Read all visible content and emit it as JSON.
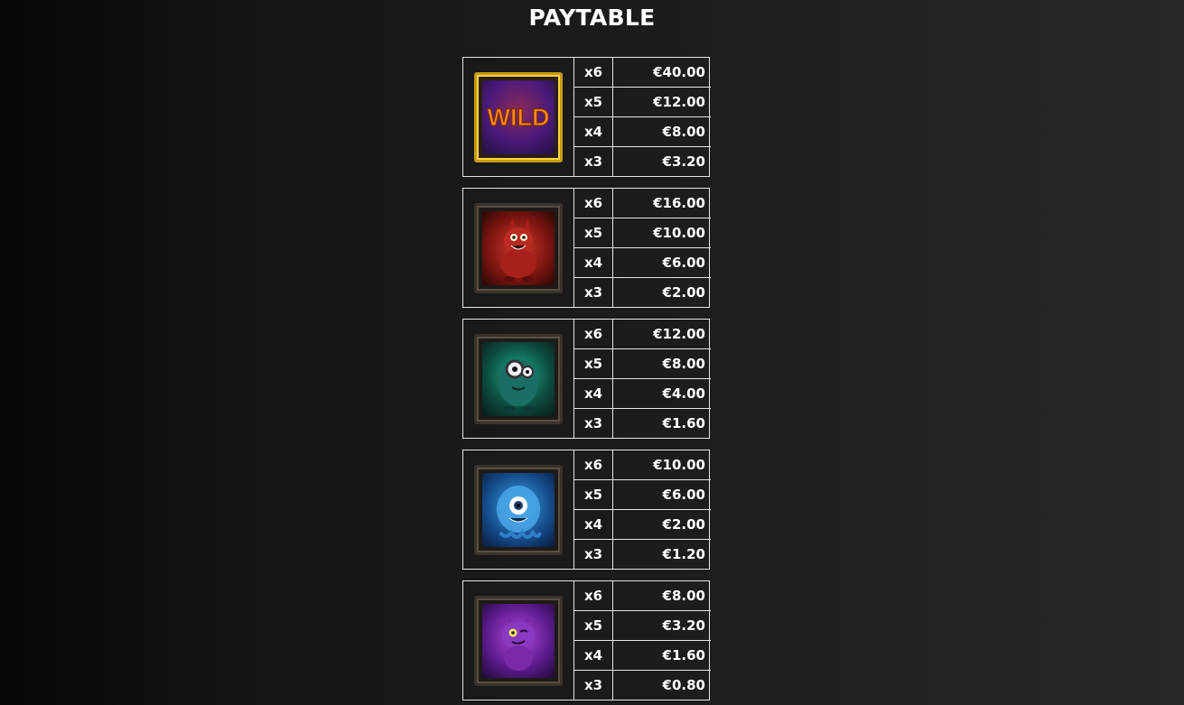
{
  "title": "PAYTABLE",
  "symbols": [
    {
      "icon": "wild-symbol-icon",
      "label": "WILD",
      "pays": [
        {
          "count": "x6",
          "amount": "€40.00"
        },
        {
          "count": "x5",
          "amount": "€12.00"
        },
        {
          "count": "x4",
          "amount": "€8.00"
        },
        {
          "count": "x3",
          "amount": "€3.20"
        }
      ]
    },
    {
      "icon": "red-monster-icon",
      "pays": [
        {
          "count": "x6",
          "amount": "€16.00"
        },
        {
          "count": "x5",
          "amount": "€10.00"
        },
        {
          "count": "x4",
          "amount": "€6.00"
        },
        {
          "count": "x3",
          "amount": "€2.00"
        }
      ]
    },
    {
      "icon": "green-monster-icon",
      "pays": [
        {
          "count": "x6",
          "amount": "€12.00"
        },
        {
          "count": "x5",
          "amount": "€8.00"
        },
        {
          "count": "x4",
          "amount": "€4.00"
        },
        {
          "count": "x3",
          "amount": "€1.60"
        }
      ]
    },
    {
      "icon": "blue-monster-icon",
      "pays": [
        {
          "count": "x6",
          "amount": "€10.00"
        },
        {
          "count": "x5",
          "amount": "€6.00"
        },
        {
          "count": "x4",
          "amount": "€2.00"
        },
        {
          "count": "x3",
          "amount": "€1.20"
        }
      ]
    },
    {
      "icon": "purple-monster-icon",
      "pays": [
        {
          "count": "x6",
          "amount": "€8.00"
        },
        {
          "count": "x5",
          "amount": "€3.20"
        },
        {
          "count": "x4",
          "amount": "€1.60"
        },
        {
          "count": "x3",
          "amount": "€0.80"
        }
      ]
    }
  ]
}
